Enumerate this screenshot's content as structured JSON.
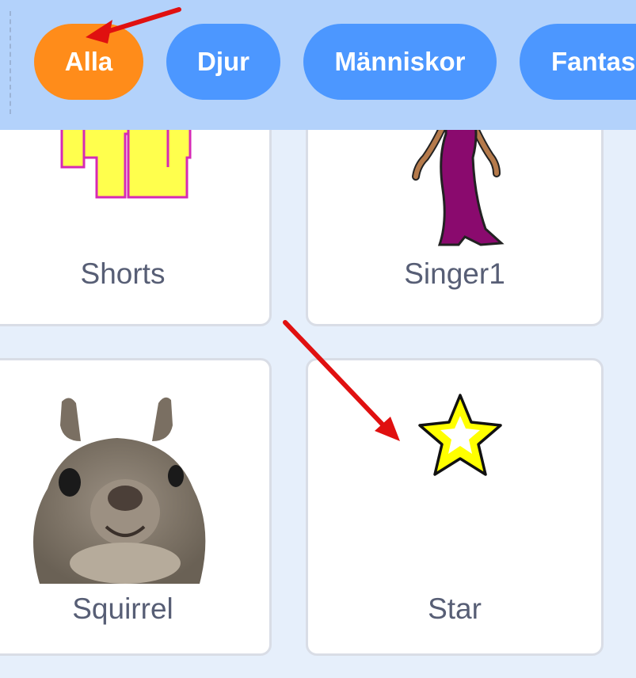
{
  "categories": [
    {
      "label": "Alla",
      "active": true
    },
    {
      "label": "Djur",
      "active": false
    },
    {
      "label": "Människor",
      "active": false
    },
    {
      "label": "Fantas",
      "active": false
    }
  ],
  "sprites": [
    {
      "name": "Shorts",
      "icon": "shorts-icon"
    },
    {
      "name": "Singer1",
      "icon": "singer-icon"
    },
    {
      "name": "Squirrel",
      "icon": "squirrel-icon"
    },
    {
      "name": "Star",
      "icon": "star-icon"
    }
  ],
  "colors": {
    "category_active": "#ff8c1a",
    "category_default": "#4c97ff",
    "topbar": "#b3d2fb",
    "background": "#e6effb",
    "annotation_arrow": "#e01010"
  }
}
